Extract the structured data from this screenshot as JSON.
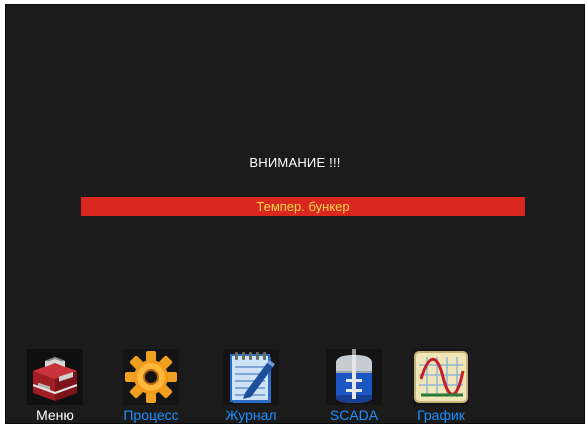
{
  "alarm_screen": {
    "title": "ВНИМАНИЕ !!!",
    "alarm_message": "Темпер. бункер"
  },
  "nav": {
    "items": [
      {
        "label": "Меню",
        "icon": "toolbox-icon",
        "color": "#ffffff"
      },
      {
        "label": "Процесс",
        "icon": "gear-icon",
        "color": "#1e90ff"
      },
      {
        "label": "Журнал",
        "icon": "journal-icon",
        "color": "#1e90ff"
      },
      {
        "label": "SCADA",
        "icon": "tank-icon",
        "color": "#1e90ff"
      },
      {
        "label": "График",
        "icon": "chart-icon",
        "color": "#1e90ff"
      }
    ]
  },
  "colors": {
    "background": "#1b1b1b",
    "alarm_bar": "#d9271f",
    "alarm_text": "#f5d84a",
    "nav_link": "#1e90ff"
  }
}
